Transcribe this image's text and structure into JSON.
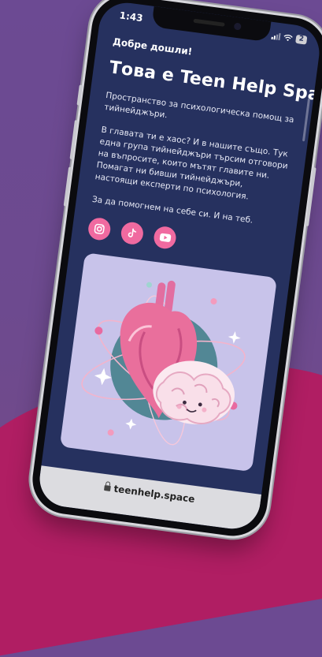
{
  "status_bar": {
    "time": "1:43",
    "battery": "2"
  },
  "page": {
    "welcome": "Добре дошли!",
    "title": "Това е Teen Help Space",
    "paragraphs": [
      "Пространство за психологическа помощ за тийнейджъри.",
      "В главата ти е хаос? И в нашите също. Тук една група тийнейджъри търсим отговори на въпросите, които мътят главите ни. Помагат ни бивши тийнейджъри, настоящи експерти по психология.",
      "За да помогнем на себе си. И на теб."
    ],
    "socials": [
      {
        "icon": "instagram-icon"
      },
      {
        "icon": "tiktok-icon"
      },
      {
        "icon": "youtube-icon"
      }
    ]
  },
  "browser": {
    "url": "teenhelp.space"
  },
  "colors": {
    "page_bg": "#26315f",
    "accent_pink": "#f06aa0",
    "hero_bg": "#c8c3ea",
    "backdrop_purple": "#6c4a93",
    "backdrop_magenta": "#b01e63"
  }
}
